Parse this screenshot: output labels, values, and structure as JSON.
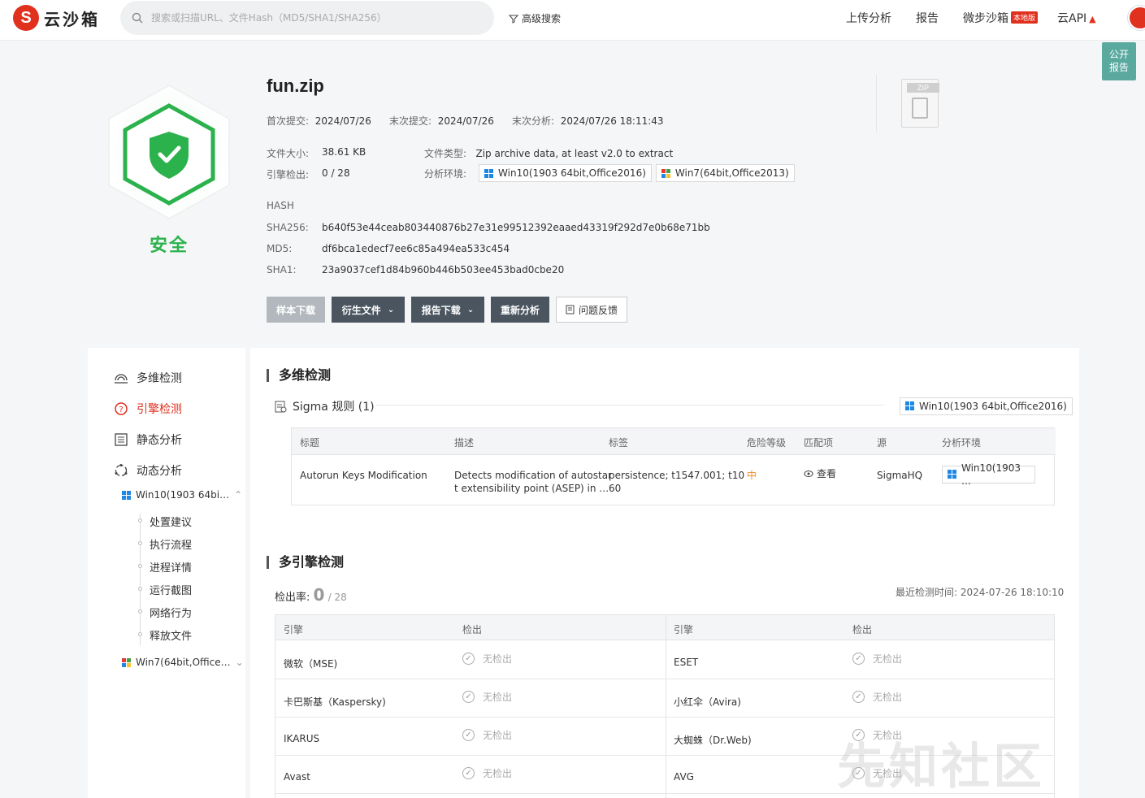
{
  "topbar": {
    "logo_text": "云沙箱",
    "search_placeholder": "搜索或扫描URL、文件Hash（MD5/SHA1/SHA256）",
    "advanced_search": "高级搜索",
    "nav": [
      "上传分析",
      "报告",
      "微步沙箱",
      "云API"
    ],
    "local_badge": "本地版",
    "public_report_line1": "公开",
    "public_report_line2": "报告"
  },
  "file": {
    "name": "fun.zip",
    "verdict": "安全",
    "first_submit_label": "首次提交:",
    "first_submit": "2024/07/26",
    "last_submit_label": "末次提交:",
    "last_submit": "2024/07/26",
    "last_analysis_label": "末次分析:",
    "last_analysis": "2024/07/26 18:11:43",
    "size_label": "文件大小:",
    "size": "38.61 KB",
    "type_label": "文件类型:",
    "type": "Zip archive data, at least v2.0 to extract",
    "engine_label": "引擎检出:",
    "engine": "0 / 28",
    "env_label": "分析环境:",
    "envs": [
      "Win10(1903 64bit,Office2016)",
      "Win7(64bit,Office2013)"
    ],
    "hash_title": "HASH",
    "sha256_label": "SHA256:",
    "sha256": "b640f53e44ceab803440876b27e31e99512392eaaed43319f292d7e0b68e71bb",
    "md5_label": "MD5:",
    "md5": "df6bca1edecf7ee6c85a494ea533c454",
    "sha1_label": "SHA1:",
    "sha1": "23a9037cef1d84b960b446b503ee453bad0cbe20",
    "zip_tag": "ZIP"
  },
  "actions": {
    "sample_download": "样本下载",
    "derived_files": "衍生文件",
    "report_download": "报告下载",
    "reanalyze": "重新分析",
    "feedback": "问题反馈"
  },
  "sidebar": {
    "items": [
      "多维检测",
      "引擎检测",
      "静态分析",
      "动态分析"
    ],
    "env1": "Win10(1903 64bi…",
    "env2": "Win7(64bit,Office…",
    "sub": [
      "处置建议",
      "执行流程",
      "进程详情",
      "运行截图",
      "网络行为",
      "释放文件"
    ]
  },
  "multi": {
    "title": "多维检测",
    "sigma_title": "Sigma 规则 (1)",
    "env": "Win10(1903 64bit,Office2016)",
    "headers": [
      "标题",
      "描述",
      "标签",
      "危险等级",
      "匹配项",
      "源",
      "分析环境"
    ],
    "row": {
      "title": "Autorun Keys Modification",
      "desc1": "Detects modification of autostar",
      "desc2": "t extensibility point (ASEP) in …",
      "tag1": "persistence; t1547.001; t10",
      "tag2": "60",
      "level": "中",
      "match": "查看",
      "source": "SigmaHQ",
      "env": "Win10(1903 …"
    }
  },
  "engines": {
    "title": "多引擎检测",
    "rate_label": "检出率:",
    "rate_value": "0",
    "rate_total": "/ 28",
    "last_time": "最近检测时间: 2024-07-26 18:10:10",
    "headers": [
      "引擎",
      "检出",
      "引擎",
      "检出"
    ],
    "result_text": "无检出",
    "left": [
      "微软（MSE)",
      "卡巴斯基（Kaspersky)",
      "IKARUS",
      "Avast"
    ],
    "right": [
      "ESET",
      "小红伞（Avira)",
      "大蜘蛛（Dr.Web)",
      "AVG"
    ]
  },
  "watermark": "先知社区",
  "colors": {
    "brand": "#e0301e",
    "safe": "#2bb24c",
    "dark_button": "#4a5560",
    "teal": "#5aa99f"
  }
}
